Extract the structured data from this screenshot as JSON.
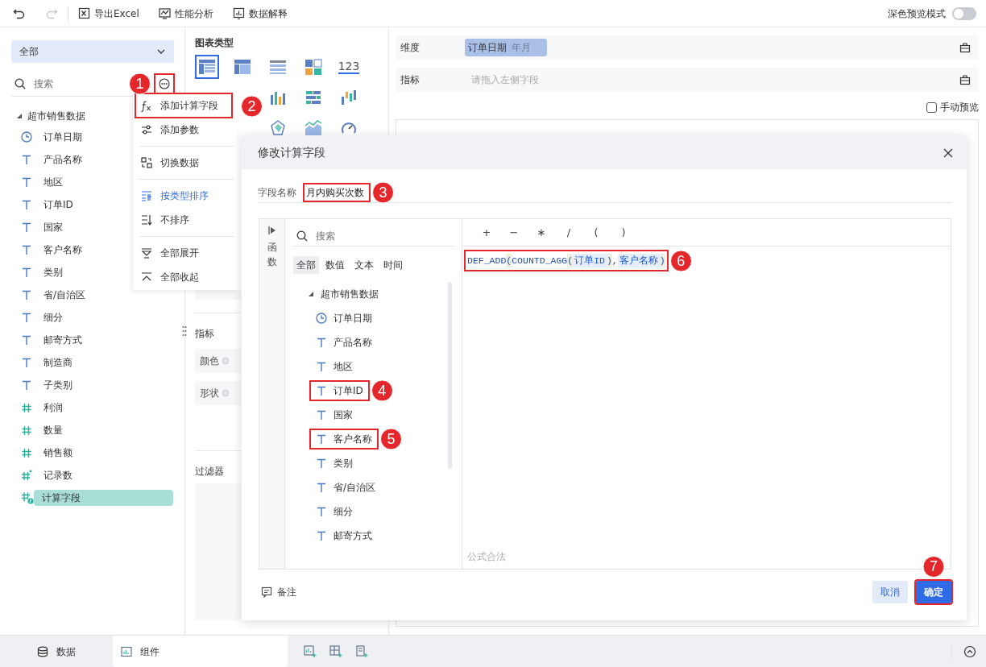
{
  "toolbar": {
    "undo": {
      "disabled": false
    },
    "redo": {
      "disabled": true
    },
    "actions": [
      {
        "label": "导出Excel",
        "kind": "export"
      },
      {
        "label": "性能分析",
        "kind": "performance"
      },
      {
        "label": "数据解释",
        "kind": "explain"
      }
    ],
    "dark_preview": {
      "label": "深色预览模式",
      "on": false
    }
  },
  "data_panel": {
    "scope": "全部",
    "search": {
      "placeholder": "搜索"
    },
    "more_button": {
      "highlighted": true,
      "annotation": "1"
    },
    "dataset": {
      "label": "超市销售数据",
      "expanded": true,
      "children": [
        {
          "label": "订单日期",
          "kind": "date",
          "selected": false
        },
        {
          "label": "产品名称",
          "kind": "text",
          "selected": false
        },
        {
          "label": "地区",
          "kind": "text",
          "selected": false
        },
        {
          "label": "订单ID",
          "kind": "text",
          "selected": false
        },
        {
          "label": "国家",
          "kind": "text",
          "selected": false
        },
        {
          "label": "客户名称",
          "kind": "text",
          "selected": false
        },
        {
          "label": "类别",
          "kind": "text",
          "selected": false
        },
        {
          "label": "省/自治区",
          "kind": "text",
          "selected": false
        },
        {
          "label": "细分",
          "kind": "text",
          "selected": false
        },
        {
          "label": "邮寄方式",
          "kind": "text",
          "selected": false
        },
        {
          "label": "制造商",
          "kind": "text",
          "selected": false
        },
        {
          "label": "子类别",
          "kind": "text",
          "selected": false
        },
        {
          "label": "利润",
          "kind": "number",
          "selected": false
        },
        {
          "label": "数量",
          "kind": "number",
          "selected": false
        },
        {
          "label": "销售额",
          "kind": "number",
          "selected": false
        },
        {
          "label": "记录数",
          "kind": "count",
          "selected": false
        },
        {
          "label": "计算字段",
          "kind": "calc",
          "selected": true
        }
      ]
    }
  },
  "context_menu": {
    "groups": [
      {
        "items": [
          {
            "label": "添加计算字段",
            "kind": "fx",
            "selected": false,
            "highlighted": true,
            "annotation": "2"
          },
          {
            "label": "添加参数",
            "kind": "param",
            "selected": false,
            "highlighted": false
          }
        ]
      },
      {
        "items": [
          {
            "label": "切换数据",
            "kind": "switch",
            "selected": false,
            "highlighted": false
          }
        ]
      },
      {
        "items": [
          {
            "label": "按类型排序",
            "kind": "sort_type",
            "selected": true,
            "highlighted": false
          },
          {
            "label": "不排序",
            "kind": "no_sort",
            "selected": false,
            "highlighted": false
          }
        ]
      },
      {
        "items": [
          {
            "label": "全部展开",
            "kind": "expand",
            "selected": false,
            "highlighted": false
          },
          {
            "label": "全部收起",
            "kind": "collapse",
            "selected": false,
            "highlighted": false
          }
        ]
      }
    ]
  },
  "chart_types": {
    "title": "图表类型",
    "items": [
      {
        "kind": "table",
        "selected": true
      },
      {
        "kind": "crosstab",
        "selected": false
      },
      {
        "kind": "detail",
        "selected": false
      },
      {
        "kind": "blocks",
        "selected": false
      },
      {
        "kind": "kpi",
        "label": "123",
        "selected": false
      },
      {
        "kind": "bar",
        "selected": false
      },
      {
        "kind": "hbar",
        "selected": false
      },
      {
        "kind": "waterfall",
        "selected": false
      },
      {
        "kind": "radar",
        "selected": false
      },
      {
        "kind": "area",
        "selected": false
      },
      {
        "kind": "gauge",
        "selected": false
      }
    ]
  },
  "encoding_panel": {
    "measure_label": "指标",
    "buttons": [
      {
        "label": "颜色"
      },
      {
        "label": "形状"
      }
    ],
    "filter_label": "过滤器"
  },
  "shelves": [
    {
      "label": "维度",
      "chips": [
        {
          "field": "订单日期",
          "granularity": "年月"
        }
      ]
    },
    {
      "label": "指标",
      "placeholder": "请拖入左侧字段"
    }
  ],
  "manual_preview": {
    "label": "手动预览",
    "checked": false
  },
  "dialog": {
    "title": "修改计算字段",
    "name_label": "字段名称",
    "name_value": "月内购买次数",
    "name_highlighted": true,
    "name_annotation": "3",
    "side_tab": "函数",
    "field_search": {
      "placeholder": "搜索"
    },
    "filters": [
      {
        "label": "全部",
        "selected": true
      },
      {
        "label": "数值",
        "selected": false
      },
      {
        "label": "文本",
        "selected": false
      },
      {
        "label": "时间",
        "selected": false
      }
    ],
    "tree": {
      "label": "超市销售数据",
      "expanded": true,
      "children": [
        {
          "label": "订单日期",
          "kind": "date",
          "highlighted": false
        },
        {
          "label": "产品名称",
          "kind": "text",
          "highlighted": false
        },
        {
          "label": "地区",
          "kind": "text",
          "highlighted": false
        },
        {
          "label": "订单ID",
          "kind": "text",
          "highlighted": true,
          "annotation": "4"
        },
        {
          "label": "国家",
          "kind": "text",
          "highlighted": false
        },
        {
          "label": "客户名称",
          "kind": "text",
          "highlighted": true,
          "annotation": "5"
        },
        {
          "label": "类别",
          "kind": "text",
          "highlighted": false
        },
        {
          "label": "省/自治区",
          "kind": "text",
          "highlighted": false
        },
        {
          "label": "细分",
          "kind": "text",
          "highlighted": false
        },
        {
          "label": "邮寄方式",
          "kind": "text",
          "highlighted": false
        }
      ]
    },
    "operators": [
      "+",
      "−",
      "∗",
      "/",
      "(",
      ")"
    ],
    "formula": {
      "highlighted": true,
      "annotation": "6",
      "parts": [
        {
          "text": "DEF_ADD",
          "kind": "function"
        },
        {
          "text": "(",
          "kind": "paren"
        },
        {
          "text": "COUNTD_AGG",
          "kind": "function"
        },
        {
          "text": "(",
          "kind": "paren"
        },
        {
          "text": "订单ID",
          "kind": "field"
        },
        {
          "text": ")",
          "kind": "paren"
        },
        {
          "text": ",",
          "kind": "punct"
        },
        {
          "text": "客户名称",
          "kind": "field"
        },
        {
          "text": ")",
          "kind": "paren"
        }
      ]
    },
    "status": "公式合法",
    "note_label": "备注",
    "buttons": [
      {
        "label": "取消",
        "kind": "secondary",
        "highlighted": false
      },
      {
        "label": "确定",
        "kind": "primary",
        "highlighted": true,
        "annotation": "7"
      }
    ]
  },
  "bottom_tabs": [
    {
      "label": "数据",
      "kind": "data",
      "selected": false
    },
    {
      "label": "组件",
      "kind": "component",
      "selected": true
    }
  ]
}
